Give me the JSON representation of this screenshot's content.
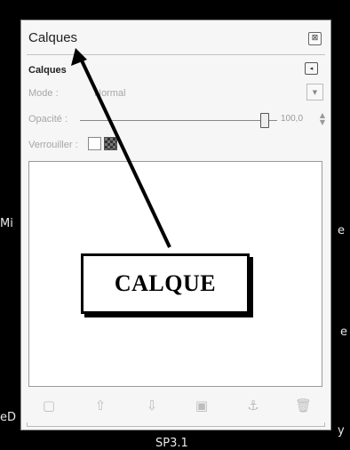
{
  "background_text": {
    "left": "Mi",
    "right_top": "e",
    "right_mid": "e",
    "bottom_left": "eD",
    "bottom_right": "y",
    "bottom_center": "SP3.1"
  },
  "dialog": {
    "title": "Calques",
    "close_glyph": "⊠",
    "dock_title": "Calques",
    "dock_menu_glyph": "◂"
  },
  "mode": {
    "label": "Mode :",
    "value": "Normal"
  },
  "opacity": {
    "label": "Opacité :",
    "value": "100,0",
    "level": 1.0
  },
  "lock": {
    "label": "Verrouiller :"
  },
  "toolbar": {
    "icons": [
      "new-layer-icon",
      "raise-layer-icon",
      "lower-layer-icon",
      "duplicate-layer-icon",
      "anchor-layer-icon",
      "delete-layer-icon"
    ],
    "glyphs": [
      "▢",
      "⇧",
      "⇩",
      "▣",
      "⚓",
      "🗑"
    ]
  },
  "annotation": {
    "label": "CALQUE"
  }
}
